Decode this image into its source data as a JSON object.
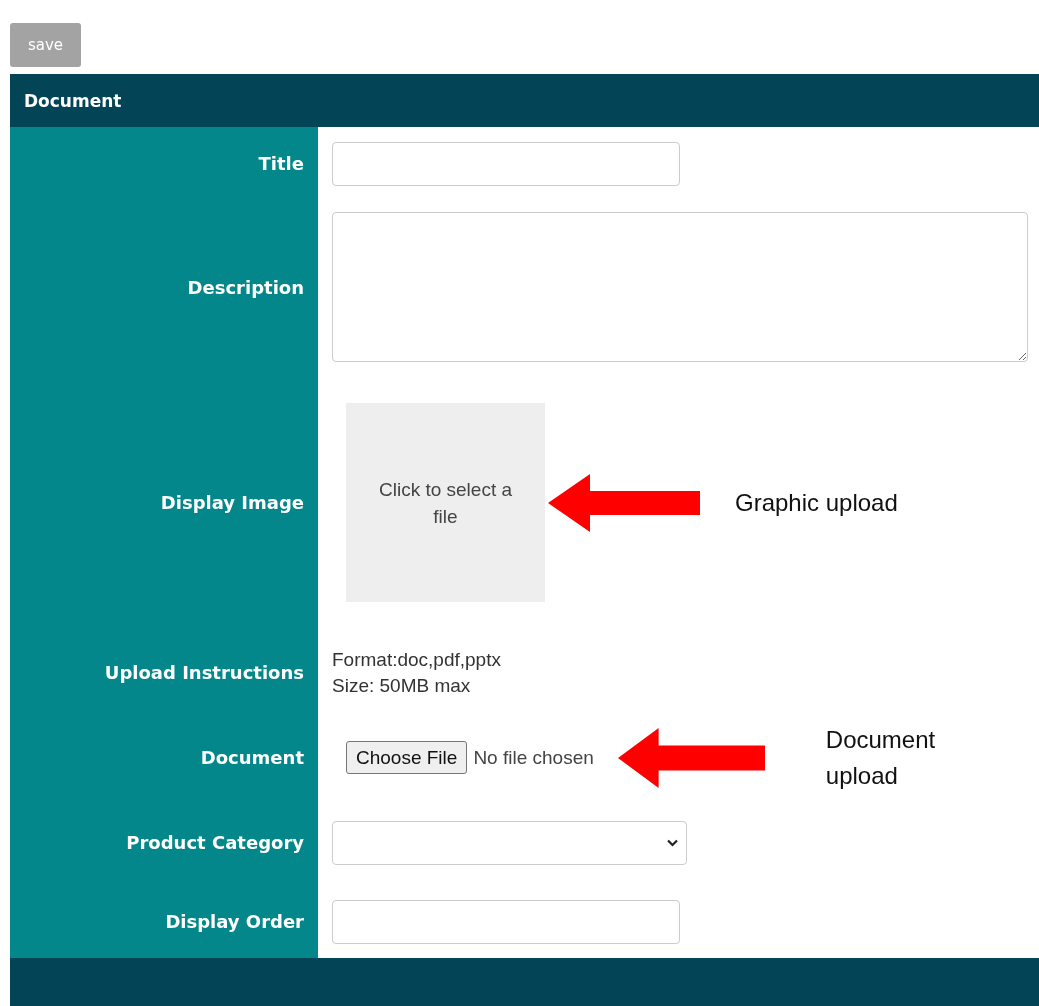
{
  "save_button": {
    "label": "save",
    "disabled": true
  },
  "form": {
    "title": "Document",
    "fields": [
      {
        "label": "Title",
        "kind": "text"
      },
      {
        "label": "Description",
        "kind": "textarea"
      },
      {
        "label": "Display Image",
        "kind": "image",
        "prompt": "Click to select a file",
        "annotation": "Graphic upload"
      },
      {
        "label": "Upload Instructions",
        "kind": "info",
        "lines": [
          "Format:doc,pdf,pptx",
          "Size: 50MB max"
        ]
      },
      {
        "label": "Document",
        "kind": "file",
        "button": "Choose File",
        "status": "No file chosen",
        "annotation": "Document upload"
      },
      {
        "label": "Product Category",
        "kind": "select"
      },
      {
        "label": "Display Order",
        "kind": "text"
      }
    ]
  }
}
